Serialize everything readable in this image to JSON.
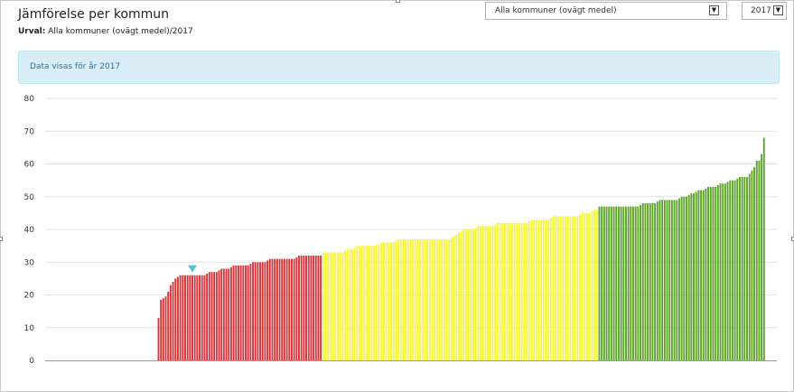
{
  "header": {
    "title": "Jämförelse per kommun",
    "subtitle_label": "Urval:",
    "subtitle_value": "Alla kommuner (ovägt medel)/2017"
  },
  "filters": {
    "municipality_select": {
      "value": "Alla kommuner (ovägt medel)",
      "arrow": "▼"
    },
    "year_select": {
      "value": "2017",
      "arrow": "▼"
    }
  },
  "info": {
    "text": "Data visas för år 2017"
  },
  "colors": {
    "red": "#d9363c",
    "yellow": "#f5f53a",
    "green": "#5fa52a",
    "marker": "#5bc0de",
    "grid": "#e3e3e3",
    "axis": "#999999"
  },
  "chart_data": {
    "type": "bar",
    "title": "",
    "xlabel": "",
    "ylabel": "",
    "ylim": [
      0,
      80
    ],
    "yticks": [
      "0",
      "10",
      "20",
      "30",
      "40",
      "50",
      "60",
      "70",
      "80"
    ],
    "grid": true,
    "legend": "none",
    "marker_index": 14,
    "series": [
      {
        "color_group": "red",
        "values": [
          13,
          18.5,
          19,
          19.5,
          21,
          23,
          24,
          25,
          25.5,
          26,
          26,
          26,
          26,
          26,
          26,
          26,
          26,
          26,
          26,
          26,
          26.5,
          27,
          27,
          27,
          27,
          27.5,
          28,
          28,
          28,
          28,
          28.5,
          29,
          29,
          29,
          29,
          29,
          29,
          29,
          29.5,
          30,
          30,
          30,
          30,
          30,
          30,
          30.5,
          31,
          31,
          31,
          31,
          31,
          31,
          31,
          31,
          31,
          31,
          31,
          31.5,
          32,
          32,
          32,
          32,
          32,
          32,
          32,
          32,
          32,
          32
        ]
      },
      {
        "color_group": "yellow",
        "values": [
          33,
          33,
          33,
          33,
          33,
          33,
          33,
          33,
          33,
          33.5,
          34,
          34,
          34,
          34.5,
          35,
          35,
          35,
          35,
          35,
          35,
          35,
          35,
          35,
          35.5,
          36,
          36,
          36,
          36,
          36,
          36,
          36.5,
          37,
          37,
          37,
          37,
          37,
          37,
          37,
          37,
          37,
          37,
          37,
          37,
          37,
          37,
          37,
          37,
          37,
          37,
          37,
          37,
          37,
          37,
          37.5,
          38,
          38.5,
          39,
          39.5,
          40,
          40,
          40,
          40,
          40,
          40.5,
          41,
          41,
          41,
          41,
          41,
          41,
          41,
          41.5,
          42,
          42,
          42,
          42,
          42,
          42,
          42,
          42,
          42,
          42,
          42,
          42,
          42,
          42.5,
          43,
          43,
          43,
          43,
          43,
          43,
          43,
          43,
          43.5,
          44,
          44,
          44,
          44,
          44,
          44,
          44,
          44,
          44,
          44,
          44,
          44.5,
          45,
          45,
          45,
          45,
          45.5,
          46,
          46
        ]
      },
      {
        "color_group": "green",
        "values": [
          47,
          47,
          47,
          47,
          47,
          47,
          47,
          47,
          47,
          47,
          47,
          47,
          47,
          47,
          47,
          47,
          47,
          47.5,
          48,
          48,
          48,
          48,
          48,
          48,
          48.5,
          49,
          49,
          49,
          49,
          49,
          49,
          49,
          49,
          49.5,
          50,
          50,
          50,
          50.5,
          51,
          51,
          51.5,
          52,
          52,
          52,
          52.5,
          53,
          53,
          53,
          53,
          53.5,
          54,
          54,
          54,
          54.5,
          55,
          55,
          55,
          55.5,
          56,
          56,
          56,
          56,
          57,
          58,
          59,
          61,
          61,
          63,
          68
        ]
      }
    ]
  }
}
